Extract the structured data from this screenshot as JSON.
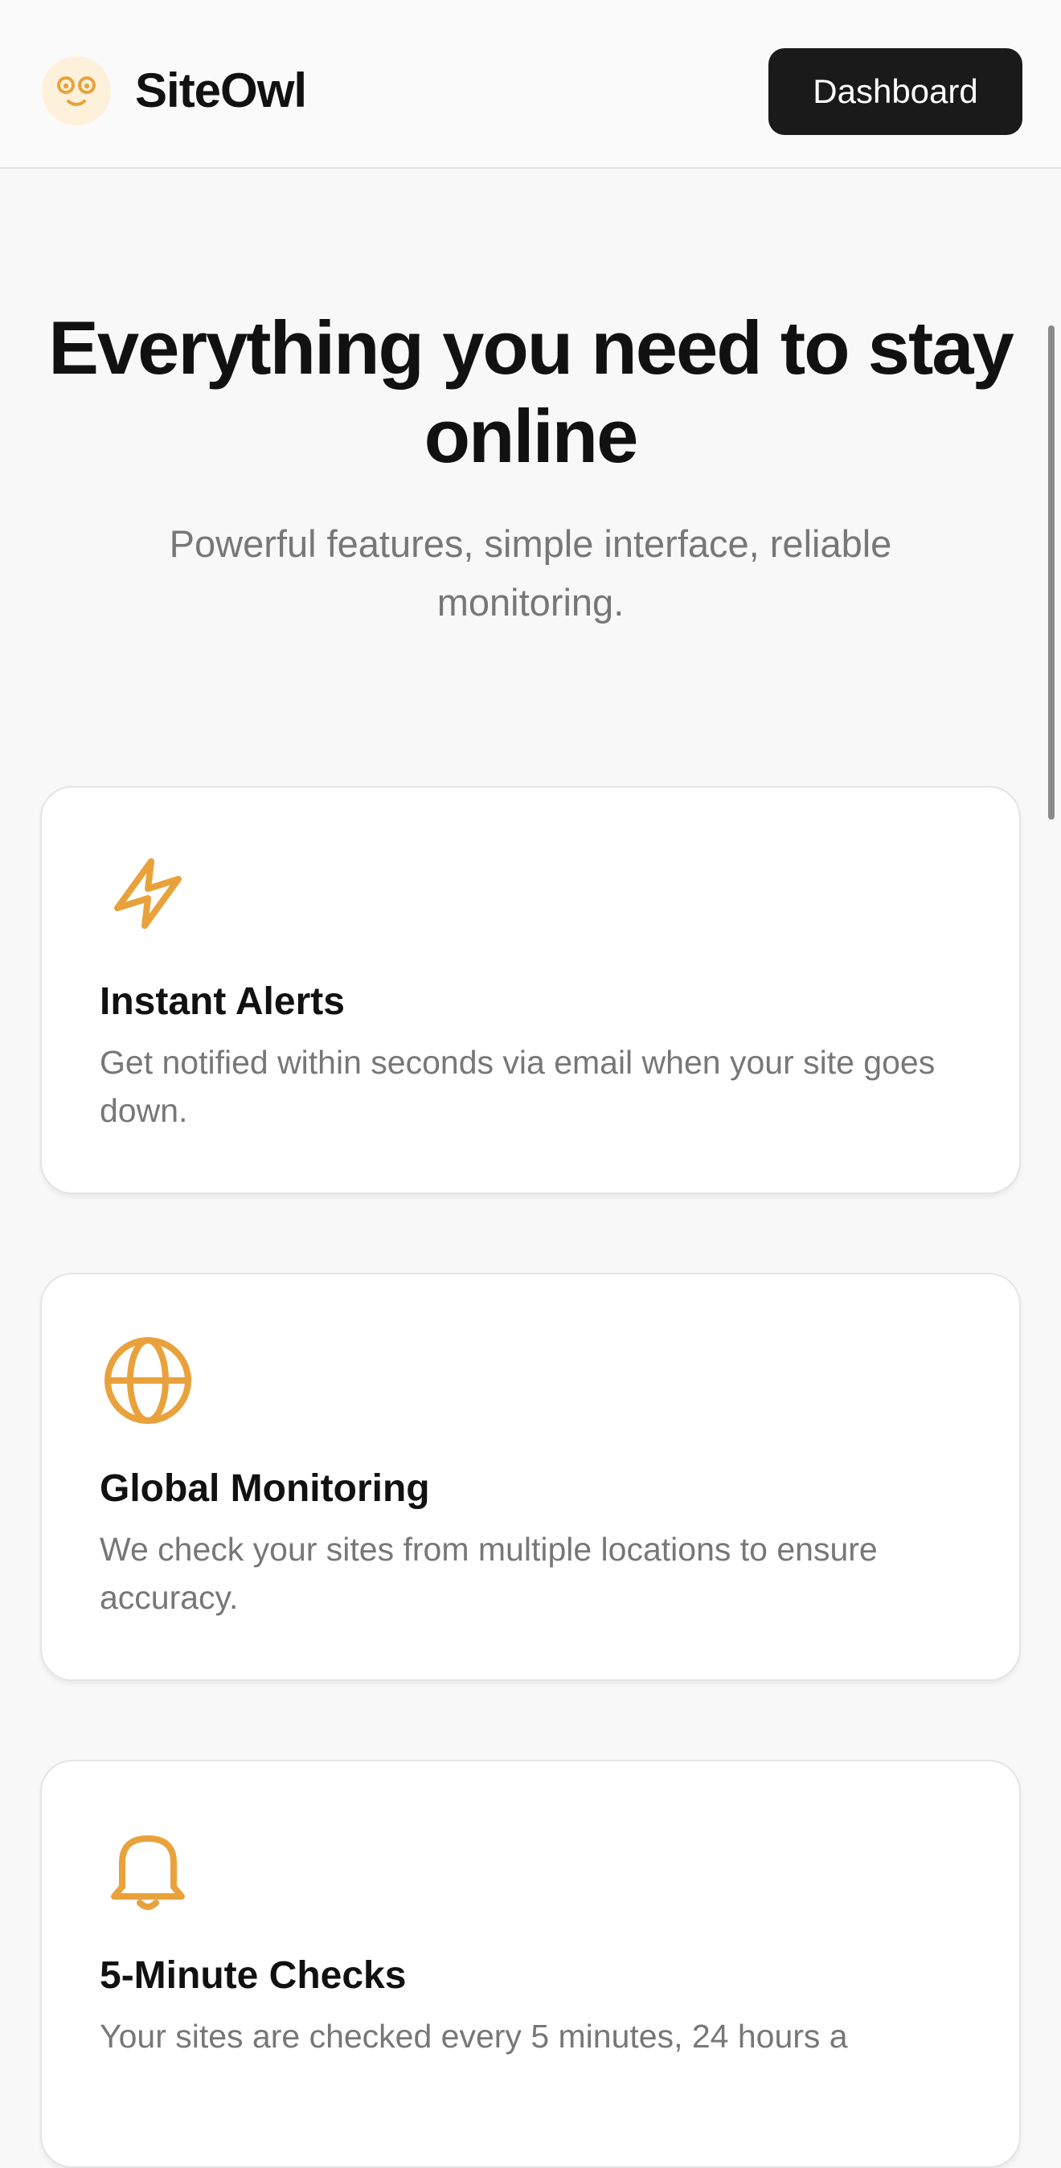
{
  "header": {
    "brand": "SiteOwl",
    "logo_icon": "owl-face-icon",
    "dashboard_label": "Dashboard"
  },
  "hero": {
    "title": "Everything you need to stay online",
    "subtitle": "Powerful features, simple interface, reliable monitoring."
  },
  "features": [
    {
      "icon": "lightning-bolt-icon",
      "title": "Instant Alerts",
      "description": "Get notified within seconds via email when your site goes down."
    },
    {
      "icon": "globe-icon",
      "title": "Global Monitoring",
      "description": "We check your sites from multiple locations to ensure accuracy."
    },
    {
      "icon": "bell-icon",
      "title": "5-Minute Checks",
      "description": "Your sites are checked every 5 minutes, 24 hours a"
    }
  ],
  "colors": {
    "accent": "#E9A23B",
    "button_bg": "#1A1A1A",
    "page_bg": "#F8F8F8",
    "muted_text": "#777777"
  }
}
